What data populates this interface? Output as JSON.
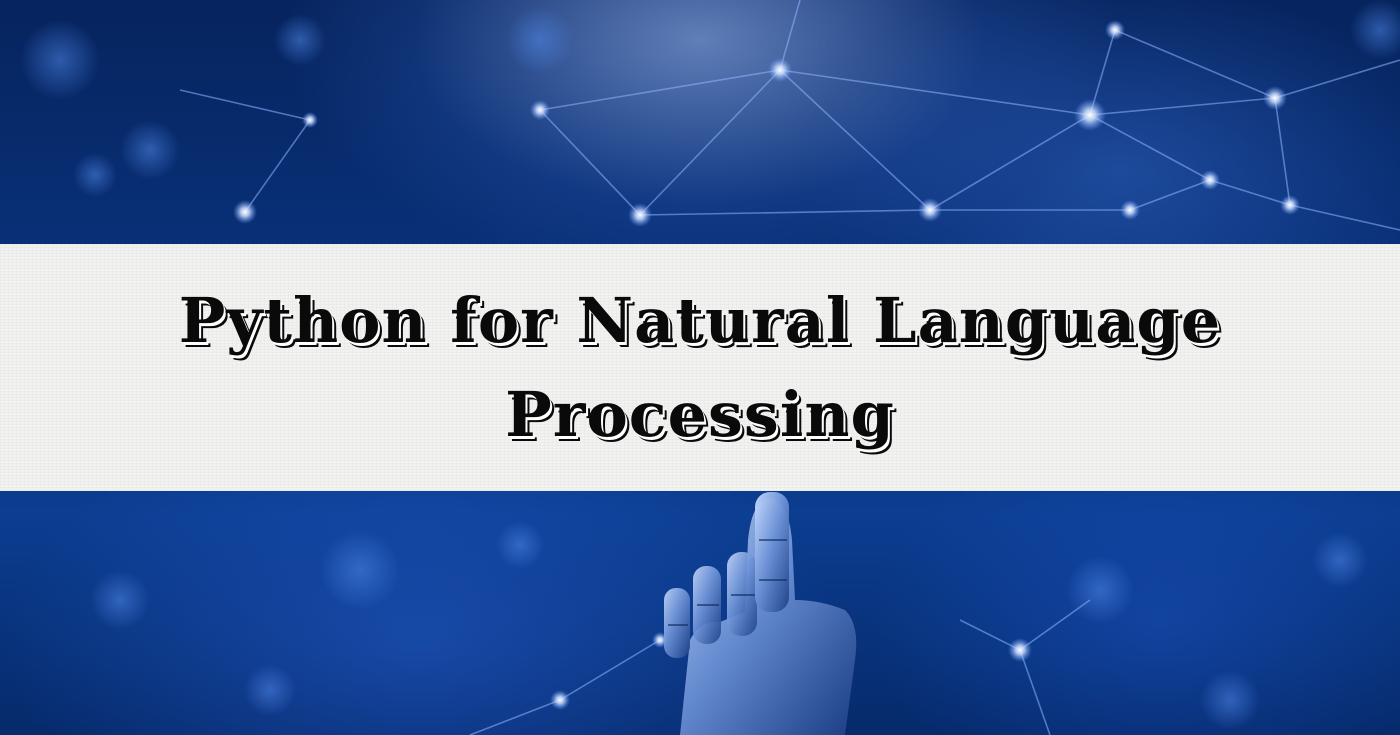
{
  "banner": {
    "title_line1": "Python for Natural Language",
    "title_line2": "Processing"
  },
  "background": {
    "description_icon": "neural-network-robot-hand",
    "colors": {
      "deep_blue": "#06245e",
      "mid_blue": "#0b3d90",
      "node_glow": "#cfe0ff",
      "band_white": "#f2f2f0",
      "title_black": "#0a0a0a"
    }
  }
}
